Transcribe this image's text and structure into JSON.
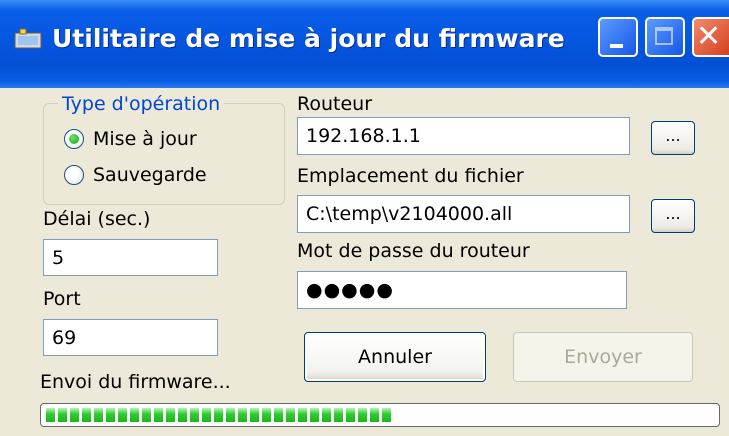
{
  "window": {
    "title": "Utilitaire de mise à jour du firmware",
    "icon": "app-window-icon"
  },
  "titlebar_buttons": {
    "minimize": "minimize-icon",
    "maximize": "maximize-icon",
    "close": "close-icon"
  },
  "operation": {
    "legend": "Type d'opération",
    "options": [
      {
        "label": "Mise à jour",
        "selected": true
      },
      {
        "label": "Sauvegarde",
        "selected": false
      }
    ]
  },
  "delay": {
    "label": "Délai (sec.)",
    "value": "5"
  },
  "port": {
    "label": "Port",
    "value": "69"
  },
  "router": {
    "label": "Routeur",
    "value": "192.168.1.1",
    "browse_label": "..."
  },
  "file": {
    "label": "Emplacement du fichier",
    "value": "C:\\temp\\v2104000.all",
    "browse_label": "..."
  },
  "password": {
    "label": "Mot de passe du routeur",
    "value": "●●●●●"
  },
  "buttons": {
    "cancel": "Annuler",
    "send": "Envoyer"
  },
  "status": {
    "text": "Envoi du firmware...",
    "progress_fraction": 0.52
  },
  "colors": {
    "titlebar": "#0556E0",
    "legend": "#0046D5",
    "progress": "#2DCB2D",
    "window_bg": "#ECE9D8"
  }
}
